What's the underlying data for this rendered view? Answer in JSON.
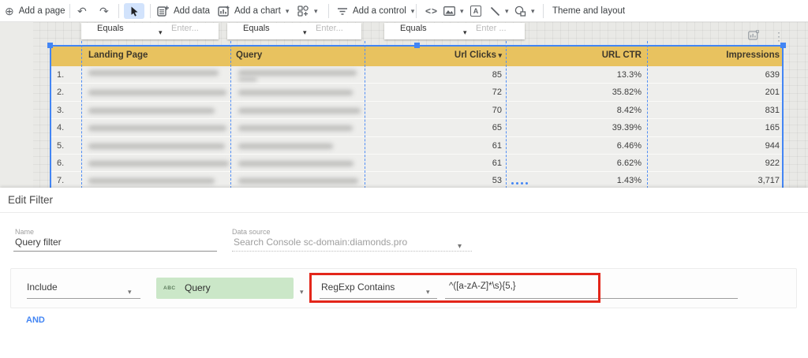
{
  "toolbar": {
    "add_page_label": "Add a page",
    "add_data_label": "Add data",
    "add_chart_label": "Add a chart",
    "add_control_label": "Add a control",
    "embed_glyph": "<>",
    "text_icon_glyph": "A",
    "theme_label": "Theme and layout"
  },
  "canvas_filters": [
    {
      "operator": "Equals",
      "placeholder": "Enter..."
    },
    {
      "operator": "Equals",
      "placeholder": "Enter..."
    },
    {
      "operator": "Equals",
      "placeholder": "Enter ..."
    }
  ],
  "table": {
    "headers": {
      "landing_page": "Landing Page",
      "query": "Query",
      "url_clicks": "Url Clicks",
      "url_ctr": "URL CTR",
      "impressions": "Impressions"
    },
    "rows": [
      {
        "index": "1.",
        "url_clicks": "85",
        "url_ctr": "13.3%",
        "impressions": "639"
      },
      {
        "index": "2.",
        "url_clicks": "72",
        "url_ctr": "35.82%",
        "impressions": "201"
      },
      {
        "index": "3.",
        "url_clicks": "70",
        "url_ctr": "8.42%",
        "impressions": "831"
      },
      {
        "index": "4.",
        "url_clicks": "65",
        "url_ctr": "39.39%",
        "impressions": "165"
      },
      {
        "index": "5.",
        "url_clicks": "61",
        "url_ctr": "6.46%",
        "impressions": "944"
      },
      {
        "index": "6.",
        "url_clicks": "61",
        "url_ctr": "6.62%",
        "impressions": "922"
      },
      {
        "index": "7.",
        "url_clicks": "53",
        "url_ctr": "1.43%",
        "impressions": "3,717"
      }
    ]
  },
  "edit_filter": {
    "title": "Edit Filter",
    "name_label": "Name",
    "name_value": "Query filter",
    "datasource_label": "Data source",
    "datasource_value": "Search Console sc-domain:diamonds.pro",
    "condition": {
      "clause": "Include",
      "field_type_icon": "ABC",
      "field": "Query",
      "operator": "RegExp Contains",
      "value": "^([a-zA-Z]*\\s){5,}"
    },
    "and_label": "AND"
  },
  "colors": {
    "accent_blue": "#4285f4",
    "table_header_gold": "#e8c25f",
    "field_chip_green": "#cbe7c8",
    "annotation_red": "#e3261a"
  }
}
